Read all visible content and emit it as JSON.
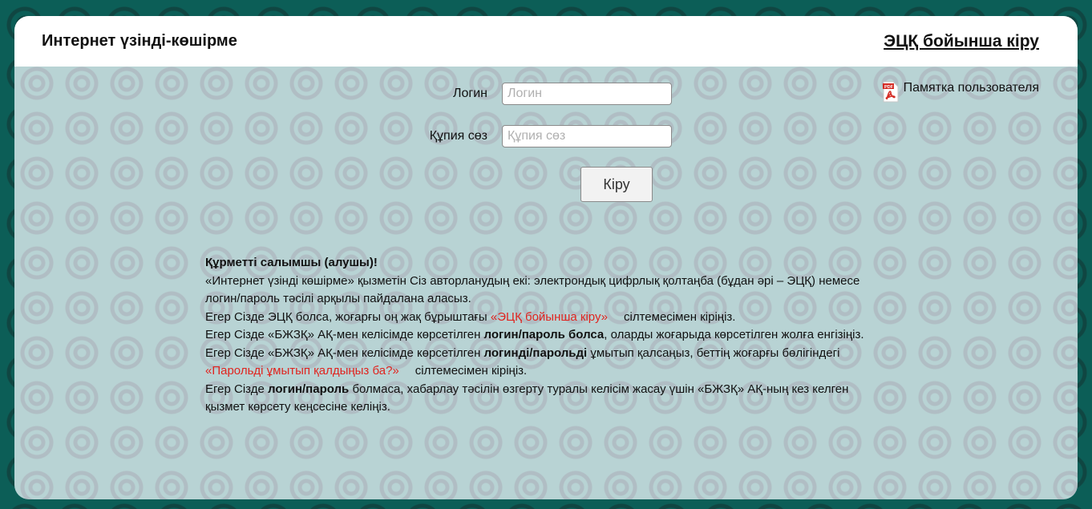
{
  "header": {
    "title": "Интернет үзінді-көшірме",
    "eds_login_link": "ЭЦҚ бойынша кіру"
  },
  "memo": {
    "label": "Памятка пользователя",
    "icon": "pdf-icon",
    "icon_text": "PDF"
  },
  "form": {
    "login_label": "Логин",
    "login_placeholder": "Логин",
    "password_label": "Құпия сөз",
    "password_placeholder": "Құпия сөз",
    "submit_label": "Кіру"
  },
  "info": {
    "greeting": "Құрметті салымшы (алушы)!",
    "line1": "«Интернет үзінді көшірме» қызметін Сіз авторланудың екі: электрондық цифрлық қолтаңба (бұдан әрі – ЭЦҚ) немесе логин/пароль тәсілі арқылы пайдалана аласыз.",
    "line2_pre": "Егер Сізде ЭЦҚ болса, жоғарғы оң жақ бұрыштағы ",
    "line2_link": "«ЭЦҚ бойынша кіру»",
    "line2_post": "сілтемесімен кіріңіз.",
    "line3_pre": "Егер Сізде «БЖЗҚ» АҚ-мен келісімде көрсетілген ",
    "line3_bold": "логин/пароль болса",
    "line3_post": ", оларды жоғарыда көрсетілген жолға енгізіңіз.",
    "line4_pre": "Егер Сізде «БЖЗҚ» АҚ-мен келісімде көрсетілген ",
    "line4_bold": "логинді/парольді",
    "line4_mid": " ұмытып қалсаңыз, беттің жоғарғы бөлігіндегі ",
    "line4_link": "«Парольді ұмытып қалдыңыз ба?»",
    "line4_post": "сілтемесімен кіріңіз.",
    "line5_pre": "Егер Сізде ",
    "line5_bold": "логин/пароль",
    "line5_post": " болмаса, хабарлау тәсілін өзгерту туралы келісім жасау үшін «БЖЗҚ» АҚ-ның кез келген қызмет көрсету кеңсесіне келіңіз."
  },
  "colors": {
    "frame": "#0c5e57",
    "panel": "#b8d3d4",
    "link_red": "#e0241f"
  }
}
